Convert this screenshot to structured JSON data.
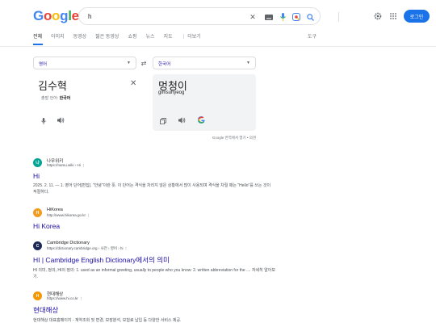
{
  "header": {
    "search_query": "h",
    "login_label": "로그인"
  },
  "tabs": [
    {
      "label": "전체"
    },
    {
      "label": "이미지"
    },
    {
      "label": "동영상"
    },
    {
      "label": "짧은 동영상"
    },
    {
      "label": "쇼핑"
    },
    {
      "label": "뉴스"
    },
    {
      "label": "지도"
    },
    {
      "label": "⋮ 더보기"
    }
  ],
  "tools_label": "도구",
  "translate": {
    "source_lang": "영어",
    "target_lang": "한국어",
    "source_text": "김수혁",
    "detected_prefix": "출발 언어:",
    "detected_lang": "한국어",
    "target_text": "멍청이",
    "target_romanization": "gimsuhyeog",
    "footer": "Google 번역에서 열기 • 의견"
  },
  "results": [
    {
      "site_name": "나무위키",
      "site_url": "https://namu.wiki › Hi ⋮",
      "title": "Hi",
      "snippet": "2025. 2. 11. — 1. 영어 단어[편집]. \"안녕\"이란 뜻. 이 단어는 격식을 차리지 않은 상황에서 많이 사용되며 격식을 차릴 때는 \"Hello\"를 쓰는 것이 적절하다.",
      "favicon_color": "#00a495",
      "favicon_glyph": "나"
    },
    {
      "site_name": "HiKorea",
      "site_url": "http://www.hikorea.go.kr ⋮",
      "title": "Hi Korea",
      "snippet": "",
      "favicon_color": "#f29c1f",
      "favicon_glyph": "H"
    },
    {
      "site_name": "Cambridge Dictionary",
      "site_url": "https://dictionary.cambridge.org › 사전 › 영어 › hi ⋮",
      "title": "HI | Cambridge English Dictionary에서의 의미",
      "snippet": "HI 의미, 정의, HI의 정의: 1. used as an informal greeting, usually to people who you know: 2. written abbreviation for the .... 자세히 알아보기.",
      "favicon_color": "#1d2a57",
      "favicon_glyph": "C"
    },
    {
      "site_name": "현대해상",
      "site_url": "https://www.hi.co.kr ⋮",
      "title": "현대해상",
      "snippet": "현대해상 대표홈페이지 - 계약조회 및 변경, 보장분석, 보험료 납입 등 다양한 서비스 제공.",
      "favicon_color": "#f39800",
      "favicon_glyph": "H"
    }
  ]
}
